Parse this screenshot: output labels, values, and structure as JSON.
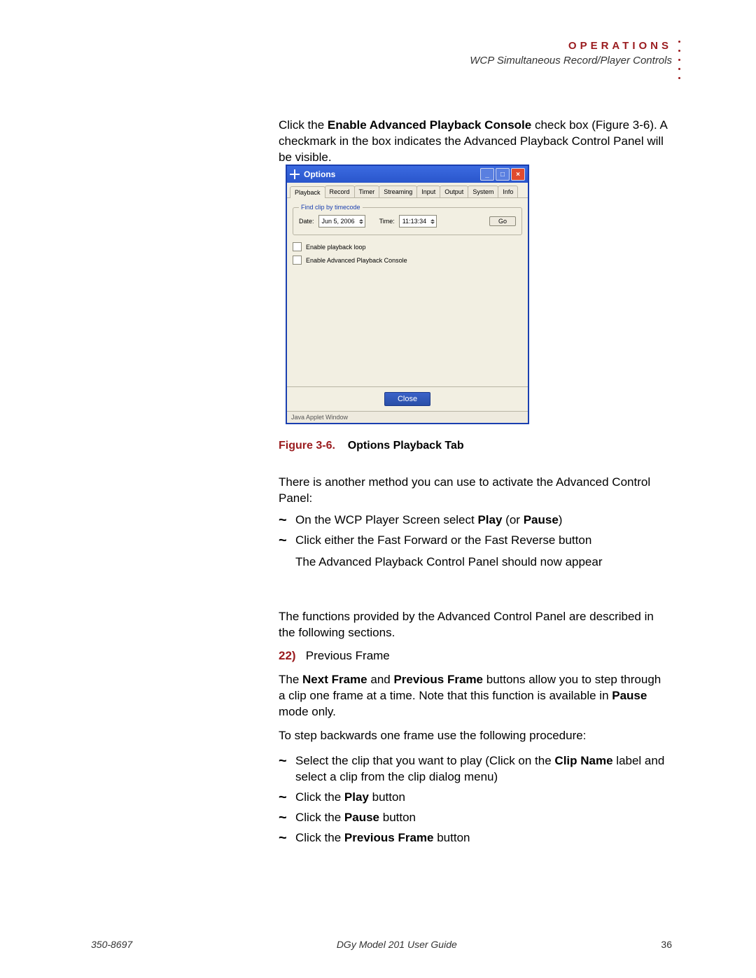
{
  "header": {
    "section": "OPERATIONS",
    "subtitle": "WCP Simultaneous Record/Player Controls"
  },
  "intro": {
    "line1a": "Click the ",
    "line1b": "Enable Advanced Playback Console",
    "line1c": " check box (Figure 3-6). A checkmark in the box indicates the Advanced Playback Control Panel will be visible."
  },
  "dialog": {
    "title": "Options",
    "tabs": [
      "Playback",
      "Record",
      "Timer",
      "Streaming",
      "Input",
      "Output",
      "System",
      "Info"
    ],
    "legend": "Find clip by timecode",
    "date_label": "Date:",
    "date_value": "Jun 5, 2006",
    "time_label": "Time:",
    "time_value": "11:13:34",
    "go": "Go",
    "chk1": "Enable playback loop",
    "chk2": "Enable Advanced Playback Console",
    "close": "Close",
    "status": "Java Applet Window"
  },
  "figcap": {
    "num": "Figure 3-6.",
    "title": "Options Playback Tab"
  },
  "para2": "There is another method you can use to activate the Advanced Control Panel:",
  "b1a": "On the WCP Player Screen select ",
  "b1b": "Play",
  "b1c": " (or ",
  "b1d": "Pause",
  "b1e": ")",
  "b2": "Click either the Fast Forward or the Fast Reverse button",
  "b2x": "The Advanced Playback Control Panel should now appear",
  "para3": "The functions provided by the Advanced Control Panel are described in the following sections.",
  "step": {
    "num": "22)",
    "title": "Previous Frame"
  },
  "p4a": "The ",
  "p4b": "Next Frame",
  "p4c": " and ",
  "p4d": "Previous Frame",
  "p4e": " buttons allow you to step through a clip one frame at a time. Note that this function is available in ",
  "p4f": "Pause",
  "p4g": " mode only.",
  "p5": "To step backwards one frame use the following procedure:",
  "c1a": "Select the clip that you want to play (Click on the ",
  "c1b": "Clip Name",
  "c1c": " label and select a clip from the clip dialog menu)",
  "c2a": "Click the ",
  "c2b": "Play",
  "c2c": " button",
  "c3a": "Click the ",
  "c3b": "Pause",
  "c3c": " button",
  "c4a": "Click the ",
  "c4b": "Previous Frame",
  "c4c": " button",
  "footer": {
    "left": "350-8697",
    "center": "DGy Model 201 User Guide",
    "right": "36"
  }
}
